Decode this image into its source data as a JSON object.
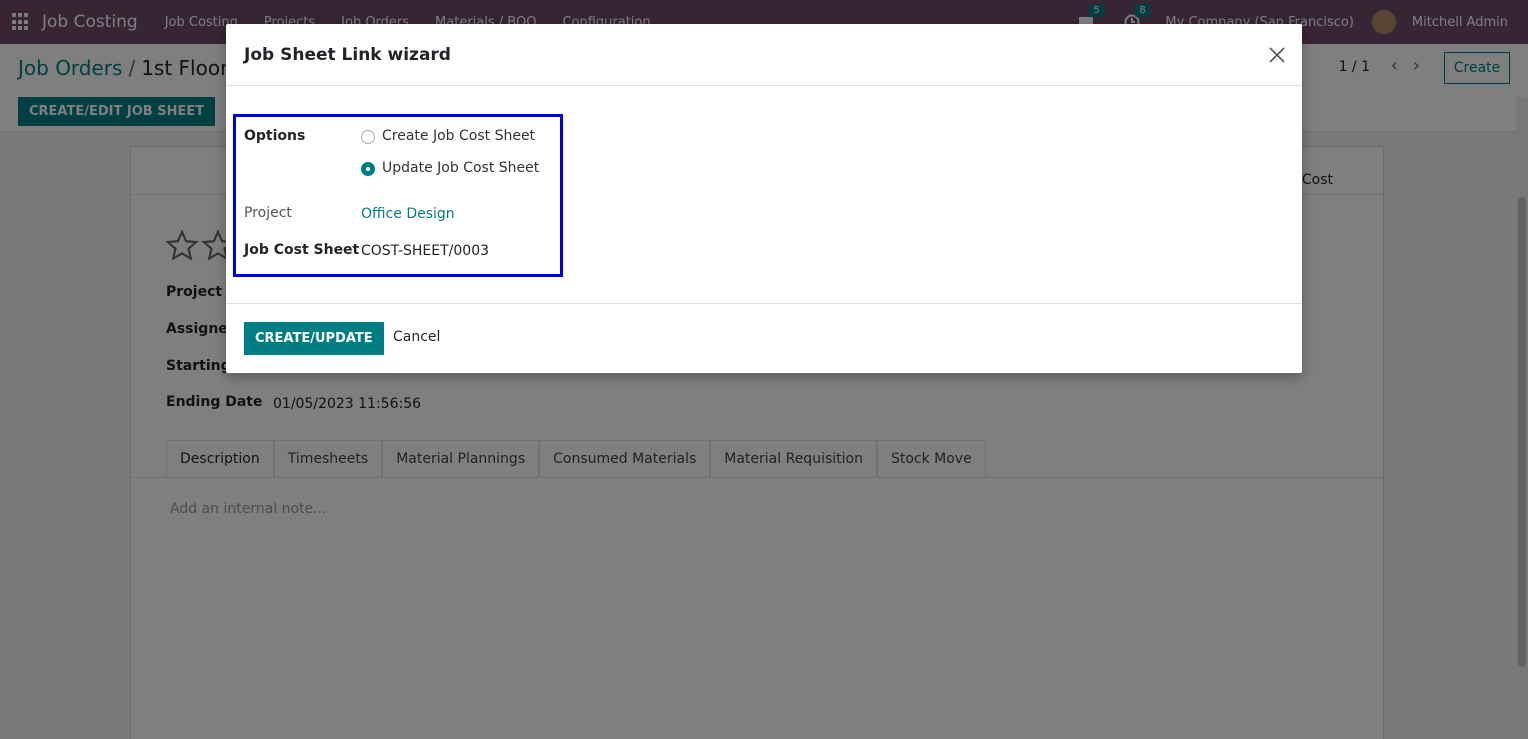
{
  "navbar": {
    "app_title": "Job Costing",
    "menu": [
      "Job Costing",
      "Projects",
      "Job Orders",
      "Materials / BOQ",
      "Configuration"
    ],
    "messages_count": "5",
    "activities_count": "8",
    "company": "My Company (San Francisco)",
    "user": "Mitchell Admin"
  },
  "control": {
    "breadcrumb_parent": "Job Orders",
    "breadcrumb_current": "1st Floor",
    "pager": "1 / 1",
    "create_label": "Create",
    "job_sheet_button": "CREATE/EDIT JOB SHEET"
  },
  "form": {
    "smart_button_text": "Cost",
    "fields": {
      "project_label": "Project",
      "assigned_label": "Assigned",
      "starting_label": "Starting",
      "ending_label": "Ending Date",
      "ending_value": "01/05/2023 11:56:56"
    },
    "tabs": [
      "Description",
      "Timesheets",
      "Material Plannings",
      "Consumed Materials",
      "Material Requisition",
      "Stock Move"
    ],
    "note_placeholder": "Add an internal note..."
  },
  "modal": {
    "title": "Job Sheet Link wizard",
    "options_label": "Options",
    "option_create": "Create Job Cost Sheet",
    "option_update": "Update Job Cost Sheet",
    "selected_option": "update",
    "project_label": "Project",
    "project_value": "Office Design",
    "cost_sheet_label": "Job Cost Sheet",
    "cost_sheet_value": "COST-SHEET/0003",
    "primary_button": "CREATE/UPDATE",
    "cancel_button": "Cancel"
  },
  "colors": {
    "navbar": "#714B67",
    "accent": "#017E84",
    "highlight": "#0000e6"
  }
}
